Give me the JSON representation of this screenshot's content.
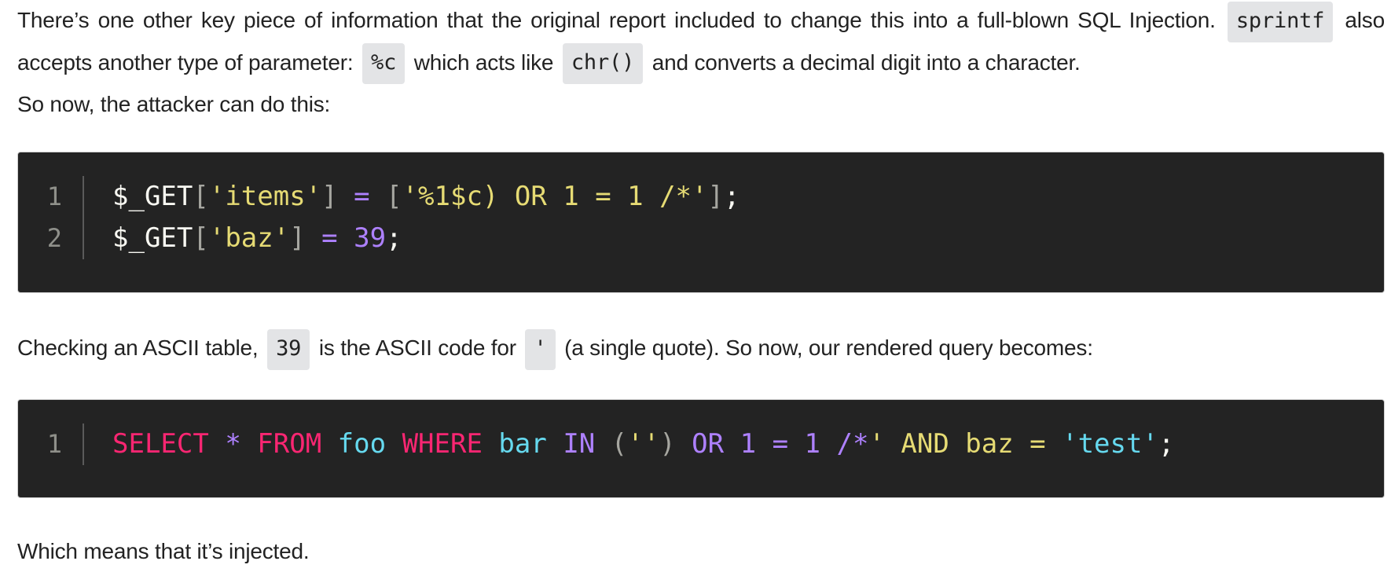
{
  "intro": {
    "t1": "There’s one other key piece of information that the original report included to change this into a full-blown SQL Injection.",
    "c1": "sprintf",
    "t2": "also accepts another type of parameter:",
    "c2": "%c",
    "t3": "which acts like",
    "c3": "chr()",
    "t4": "and converts a decimal digit into a character.",
    "t5": "So now, the attacker can do this:"
  },
  "code_block_1": {
    "line_numbers": [
      "1",
      "2"
    ],
    "lines": [
      [
        {
          "text": "$_GET",
          "kind": "var"
        },
        {
          "text": "[",
          "kind": "punc"
        },
        {
          "text": "'items'",
          "kind": "str"
        },
        {
          "text": "]",
          "kind": "punc"
        },
        {
          "text": " ",
          "kind": "var"
        },
        {
          "text": "=",
          "kind": "op"
        },
        {
          "text": " ",
          "kind": "var"
        },
        {
          "text": "[",
          "kind": "punc"
        },
        {
          "text": "'%1$c) OR 1 = 1 /*'",
          "kind": "str"
        },
        {
          "text": "]",
          "kind": "punc"
        },
        {
          "text": ";",
          "kind": "semi"
        }
      ],
      [
        {
          "text": "$_GET",
          "kind": "var"
        },
        {
          "text": "[",
          "kind": "punc"
        },
        {
          "text": "'baz'",
          "kind": "str"
        },
        {
          "text": "]",
          "kind": "punc"
        },
        {
          "text": " ",
          "kind": "var"
        },
        {
          "text": "=",
          "kind": "op"
        },
        {
          "text": " ",
          "kind": "var"
        },
        {
          "text": "39",
          "kind": "num"
        },
        {
          "text": ";",
          "kind": "semi"
        }
      ]
    ]
  },
  "middle": {
    "t1": "Checking an ASCII table,",
    "c1": "39",
    "t2": "is the ASCII code for",
    "c2": "'",
    "t3": "(a single quote). So now, our rendered query becomes:"
  },
  "code_block_2": {
    "line_numbers": [
      "1"
    ],
    "lines": [
      [
        {
          "text": "SELECT",
          "kind": "kw"
        },
        {
          "text": " ",
          "kind": "var"
        },
        {
          "text": "*",
          "kind": "op"
        },
        {
          "text": " ",
          "kind": "var"
        },
        {
          "text": "FROM",
          "kind": "kw"
        },
        {
          "text": " ",
          "kind": "var"
        },
        {
          "text": "foo",
          "kind": "id"
        },
        {
          "text": " ",
          "kind": "var"
        },
        {
          "text": "WHERE",
          "kind": "kw"
        },
        {
          "text": " ",
          "kind": "var"
        },
        {
          "text": "bar",
          "kind": "id"
        },
        {
          "text": " ",
          "kind": "var"
        },
        {
          "text": "IN",
          "kind": "kw2"
        },
        {
          "text": " ",
          "kind": "var"
        },
        {
          "text": "(",
          "kind": "punc"
        },
        {
          "text": "''",
          "kind": "str"
        },
        {
          "text": ")",
          "kind": "punc"
        },
        {
          "text": " ",
          "kind": "var"
        },
        {
          "text": "OR",
          "kind": "kw2"
        },
        {
          "text": " ",
          "kind": "var"
        },
        {
          "text": "1",
          "kind": "num"
        },
        {
          "text": " ",
          "kind": "var"
        },
        {
          "text": "=",
          "kind": "op"
        },
        {
          "text": " ",
          "kind": "var"
        },
        {
          "text": "1",
          "kind": "num"
        },
        {
          "text": " ",
          "kind": "var"
        },
        {
          "text": "/*",
          "kind": "op"
        },
        {
          "text": "' AND baz = ",
          "kind": "str"
        },
        {
          "text": "'test'",
          "kind": "id"
        },
        {
          "text": ";",
          "kind": "semi"
        }
      ]
    ]
  },
  "closing": {
    "t1": "Which means that it’s injected."
  },
  "syntax_colors": {
    "var": "#f8f8f2",
    "punc": "#a6a6a0",
    "str": "#e6db74",
    "op": "#ae81ff",
    "num": "#ae81ff",
    "semi": "#f8f8f2",
    "kw": "#f92672",
    "id": "#66d9ef",
    "kw2": "#ae81ff"
  }
}
